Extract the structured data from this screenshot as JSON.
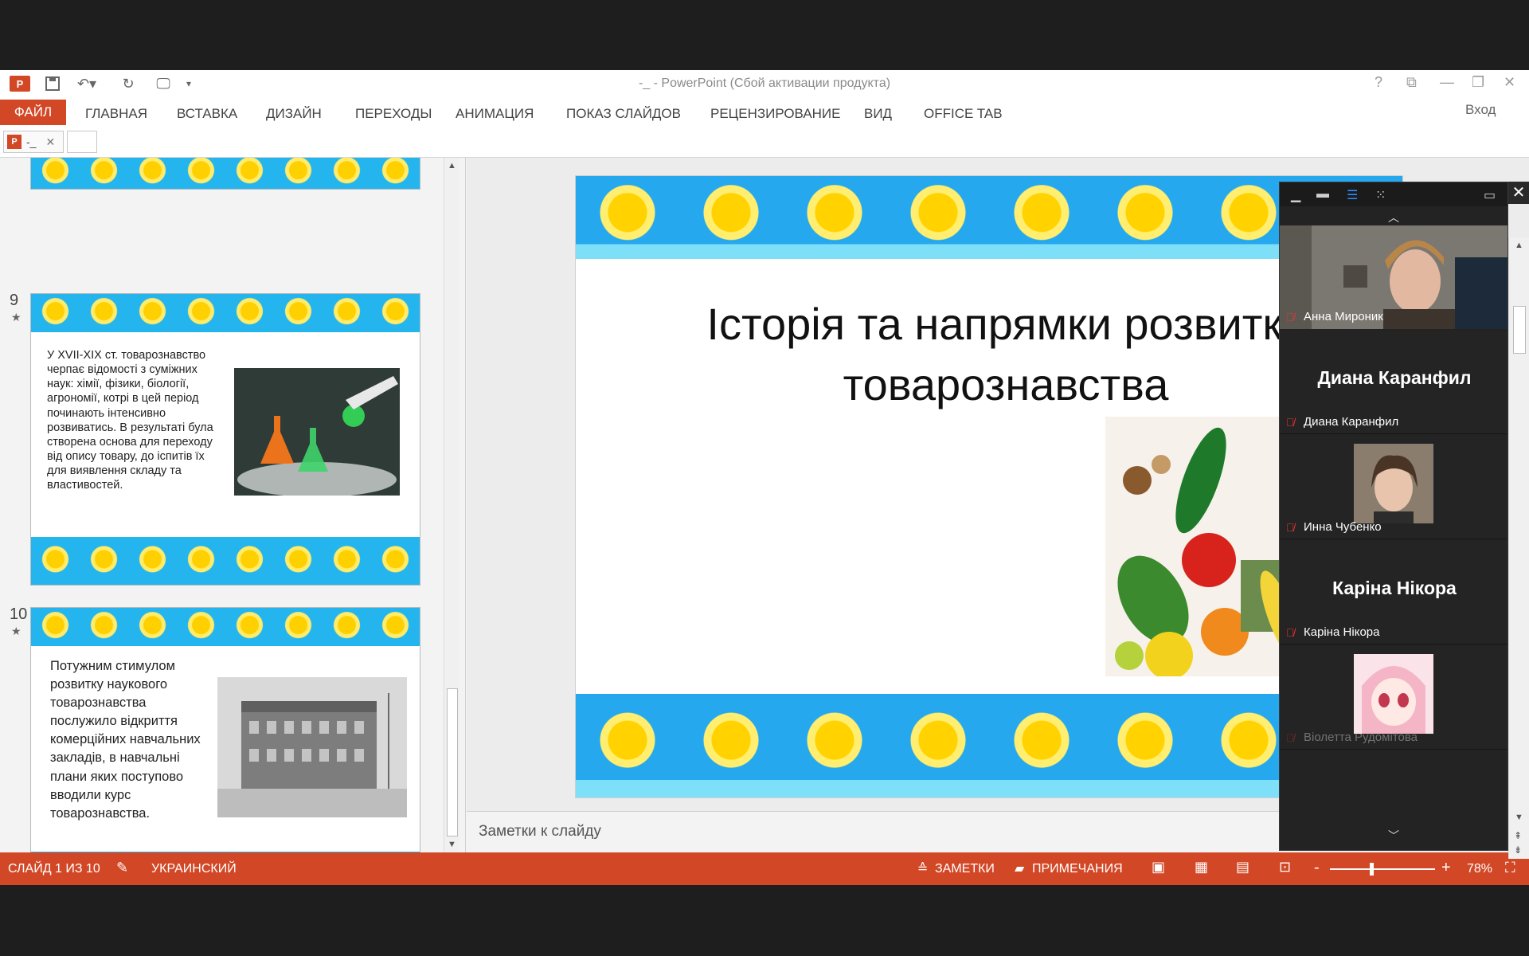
{
  "window": {
    "title": "-_ - PowerPoint (Сбой активации продукта)",
    "signin": "Вход"
  },
  "ribbon": {
    "file": "ФАЙЛ",
    "tabs": [
      "ГЛАВНАЯ",
      "ВСТАВКА",
      "ДИЗАЙН",
      "ПЕРЕХОДЫ",
      "АНИМАЦИЯ",
      "ПОКАЗ СЛАЙДОВ",
      "РЕЦЕНЗИРОВАНИЕ",
      "ВИД",
      "OFFICE TAB"
    ]
  },
  "doc_tab": {
    "name": "-_"
  },
  "thumbnails": [
    {
      "number": "9",
      "text": "У XVII-XIX ст. товарознавство черпає відомості з суміжних наук: хімії, фізики, біології, агрономії, котрі в цей період починають інтенсивно розвиватись. В результаті була створена основа для переходу від опису товару, до іспитів їх для виявлення складу та властивостей."
    },
    {
      "number": "10",
      "text": "Потужним стимулом розвитку наукового товарознавства послужило відкриття комерційних навчальних закладів, в навчальні плани яких поступово вводили курс товарознавства."
    }
  ],
  "slide": {
    "title_line1": "Історія та напрямки розвитку",
    "title_line2": "товарознавства"
  },
  "notes": {
    "placeholder": "Заметки к слайду"
  },
  "status": {
    "slide_info": "СЛАЙД 1 ИЗ 10",
    "language": "УКРАИНСКИЙ",
    "notes": "ЗАМЕТКИ",
    "comments": "ПРИМЕЧАНИЯ",
    "zoom_minus": "-",
    "zoom_plus": "+",
    "zoom_level": "78%"
  },
  "participants": [
    {
      "name": "Анна Мироник",
      "type": "video"
    },
    {
      "name": "Диана Каранфил",
      "type": "name"
    },
    {
      "name": "Инна Чубенко",
      "type": "avatar"
    },
    {
      "name": "Каріна Нікора",
      "type": "name"
    },
    {
      "name": "Віолетта Рудомітова",
      "type": "avatar"
    }
  ],
  "colors": {
    "accent": "#d24726",
    "sky": "#25b5ee",
    "sun": "#ffd000"
  }
}
